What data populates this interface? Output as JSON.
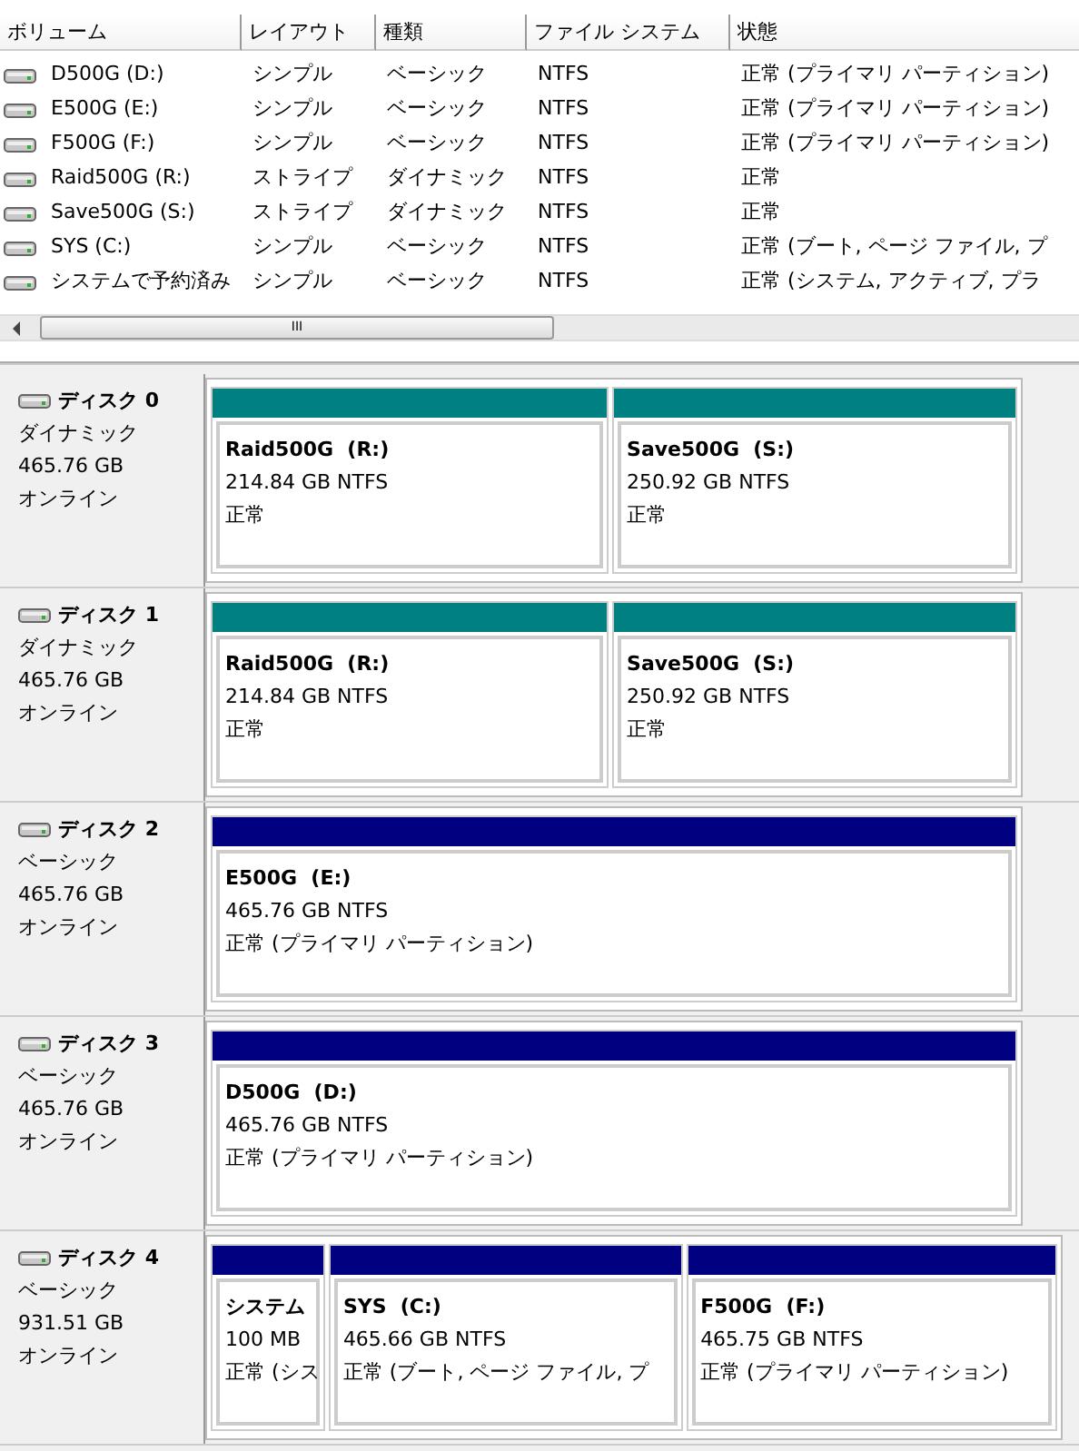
{
  "volume_list": {
    "columns": [
      "ボリューム",
      "レイアウト",
      "種類",
      "ファイル システム",
      "状態"
    ],
    "rows": [
      {
        "cells": [
          "D500G (D:)",
          "シンプル",
          "ベーシック",
          "NTFS",
          "正常 (プライマリ パーティション)"
        ]
      },
      {
        "cells": [
          "E500G (E:)",
          "シンプル",
          "ベーシック",
          "NTFS",
          "正常 (プライマリ パーティション)"
        ]
      },
      {
        "cells": [
          "F500G (F:)",
          "シンプル",
          "ベーシック",
          "NTFS",
          "正常 (プライマリ パーティション)"
        ]
      },
      {
        "cells": [
          "Raid500G (R:)",
          "ストライプ",
          "ダイナミック",
          "NTFS",
          "正常"
        ]
      },
      {
        "cells": [
          "Save500G (S:)",
          "ストライプ",
          "ダイナミック",
          "NTFS",
          "正常"
        ]
      },
      {
        "cells": [
          "SYS (C:)",
          "シンプル",
          "ベーシック",
          "NTFS",
          "正常 (ブート, ページ ファイル, プ"
        ]
      },
      {
        "cells": [
          "システムで予約済み",
          "シンプル",
          "ベーシック",
          "NTFS",
          "正常 (システム, アクティブ, プラ"
        ]
      }
    ],
    "scrollbar_grip": "III"
  },
  "disks": [
    {
      "name": "ディスク 0",
      "type": "ダイナミック",
      "size": "465.76 GB",
      "status": "オンライン",
      "partitions": [
        {
          "name": "Raid500G  (R:)",
          "size": "214.84 GB NTFS",
          "status": "正常",
          "color": "#008080"
        },
        {
          "name": "Save500G  (S:)",
          "size": "250.92 GB NTFS",
          "status": "正常",
          "color": "#008080"
        }
      ]
    },
    {
      "name": "ディスク 1",
      "type": "ダイナミック",
      "size": "465.76 GB",
      "status": "オンライン",
      "partitions": [
        {
          "name": "Raid500G  (R:)",
          "size": "214.84 GB NTFS",
          "status": "正常",
          "color": "#008080"
        },
        {
          "name": "Save500G  (S:)",
          "size": "250.92 GB NTFS",
          "status": "正常",
          "color": "#008080"
        }
      ]
    },
    {
      "name": "ディスク 2",
      "type": "ベーシック",
      "size": "465.76 GB",
      "status": "オンライン",
      "partitions": [
        {
          "name": "E500G  (E:)",
          "size": "465.76 GB NTFS",
          "status": "正常 (プライマリ パーティション)",
          "color": "#000080"
        }
      ]
    },
    {
      "name": "ディスク 3",
      "type": "ベーシック",
      "size": "465.76 GB",
      "status": "オンライン",
      "partitions": [
        {
          "name": "D500G  (D:)",
          "size": "465.76 GB NTFS",
          "status": "正常 (プライマリ パーティション)",
          "color": "#000080"
        }
      ]
    },
    {
      "name": "ディスク 4",
      "type": "ベーシック",
      "size": "931.51 GB",
      "status": "オンライン",
      "partitions": [
        {
          "name": "システム",
          "size": "100 MB",
          "status": "正常 (シス",
          "color": "#000080"
        },
        {
          "name": "SYS  (C:)",
          "size": "465.66 GB NTFS",
          "status": "正常 (ブート, ページ ファイル, プ",
          "color": "#000080"
        },
        {
          "name": "F500G  (F:)",
          "size": "465.75 GB NTFS",
          "status": "正常 (プライマリ パーティション)",
          "color": "#000080"
        }
      ]
    }
  ]
}
